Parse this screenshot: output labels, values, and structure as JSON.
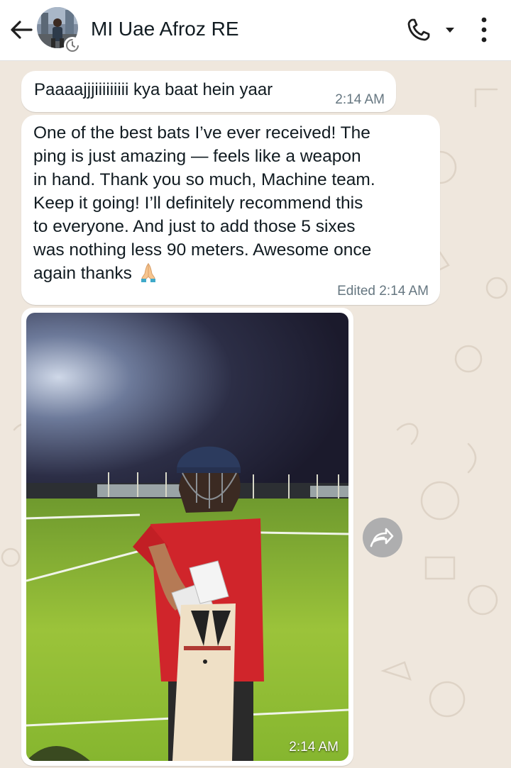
{
  "header": {
    "title": "MI Uae Afroz RE",
    "back_icon": "arrow-left-icon",
    "call_icon": "phone-icon",
    "dropdown_icon": "caret-down-icon",
    "menu_icon": "more-vertical-icon"
  },
  "messages": [
    {
      "text": "Paaaajjjiiiiiiiii kya baat hein yaar",
      "time": "2:14 AM"
    },
    {
      "lines": [
        "One of the best bats I’ve ever received! The",
        "ping is just amazing — feels like a weapon",
        "in hand. Thank you so much, Machine team.",
        "Keep it going! I’ll definitely recommend this",
        "to everyone. And just to add those 5 sixes",
        "was nothing less 90 meters. Awesome once",
        "again thanks"
      ],
      "emoji": "folded-hands-icon",
      "meta": "Edited 2:14 AM"
    },
    {
      "type": "image",
      "time": "2:14 AM"
    }
  ],
  "forward_icon": "forward-arrow-icon",
  "colors": {
    "wallpaper": "#efe7dd",
    "bubble": "#ffffff",
    "meta_text": "#667781",
    "primary_text": "#111b21"
  }
}
